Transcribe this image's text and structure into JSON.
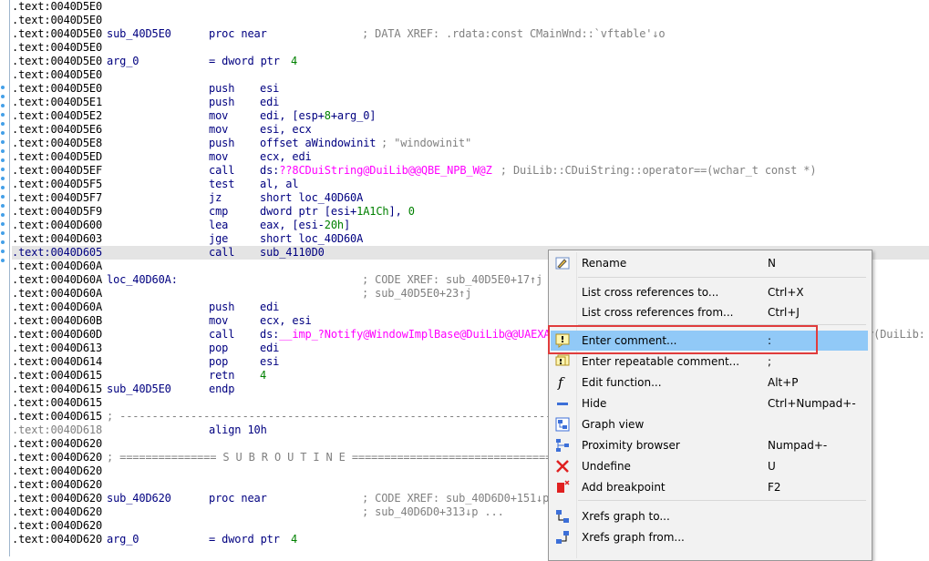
{
  "listing": {
    "rows": [
      {
        "seg": ".text:",
        "addr": "0040D5E0"
      },
      {
        "seg": ".text:",
        "addr": "0040D5E0"
      },
      {
        "seg": ".text:",
        "addr": "0040D5E0",
        "label": "sub_40D5E0",
        "mnem": "proc near",
        "comment": "; DATA XREF: .rdata:const CMainWnd::`vftable'↓o"
      },
      {
        "seg": ".text:",
        "addr": "0040D5E0"
      },
      {
        "seg": ".text:",
        "addr": "0040D5E0",
        "label": "arg_0",
        "mnem": "= dword ptr",
        "op": "4"
      },
      {
        "seg": ".text:",
        "addr": "0040D5E0"
      },
      {
        "seg": ".text:",
        "addr": "0040D5E0",
        "mnem": "push",
        "op": "esi"
      },
      {
        "seg": ".text:",
        "addr": "0040D5E1",
        "mnem": "push",
        "op": "edi"
      },
      {
        "seg": ".text:",
        "addr": "0040D5E2",
        "mnem": "mov",
        "op": "edi, [esp+8+arg_0]"
      },
      {
        "seg": ".text:",
        "addr": "0040D5E6",
        "mnem": "mov",
        "op": "esi, ecx"
      },
      {
        "seg": ".text:",
        "addr": "0040D5E8",
        "mnem": "push",
        "op": "offset aWindowinit",
        "comment": "; \"windowinit\""
      },
      {
        "seg": ".text:",
        "addr": "0040D5ED",
        "mnem": "mov",
        "op": "ecx, edi"
      },
      {
        "seg": ".text:",
        "addr": "0040D5EF",
        "mnem": "call",
        "op": "ds:??8CDuiString@DuiLib@@QBE_NPB_W@Z",
        "comment": "; DuiLib::CDuiString::operator==(wchar_t const *)"
      },
      {
        "seg": ".text:",
        "addr": "0040D5F5",
        "mnem": "test",
        "op": "al, al"
      },
      {
        "seg": ".text:",
        "addr": "0040D5F7",
        "mnem": "jz",
        "op": "short loc_40D60A"
      },
      {
        "seg": ".text:",
        "addr": "0040D5F9",
        "mnem": "cmp",
        "op": "dword ptr [esi+1A1Ch], 0"
      },
      {
        "seg": ".text:",
        "addr": "0040D600",
        "mnem": "lea",
        "op": "eax, [esi-20h]"
      },
      {
        "seg": ".text:",
        "addr": "0040D603",
        "mnem": "jge",
        "op": "short loc_40D60A"
      },
      {
        "seg": ".text:",
        "addr": "0040D605",
        "mnem": "call",
        "op": "sub_4110D0"
      },
      {
        "seg": ".text:",
        "addr": "0040D60A"
      },
      {
        "seg": ".text:",
        "addr": "0040D60A",
        "label": "loc_40D60A:",
        "comment": "; CODE XREF: sub_40D5E0+17↑j"
      },
      {
        "seg": ".text:",
        "addr": "0040D60A",
        "comment": "; sub_40D5E0+23↑j"
      },
      {
        "seg": ".text:",
        "addr": "0040D60A",
        "mnem": "push",
        "op": "edi"
      },
      {
        "seg": ".text:",
        "addr": "0040D60B",
        "mnem": "mov",
        "op": "ecx, esi"
      },
      {
        "seg": ".text:",
        "addr": "0040D60D",
        "mnem": "call",
        "op": "ds:__imp_?Notify@WindowImplBase@DuiLib@@UAEXA",
        "tail": "fy(DuiLib:"
      },
      {
        "seg": ".text:",
        "addr": "0040D613",
        "mnem": "pop",
        "op": "edi"
      },
      {
        "seg": ".text:",
        "addr": "0040D614",
        "mnem": "pop",
        "op": "esi"
      },
      {
        "seg": ".text:",
        "addr": "0040D615",
        "mnem": "retn",
        "op": "4"
      },
      {
        "seg": ".text:",
        "addr": "0040D615",
        "label": "sub_40D5E0",
        "mnem": "endp"
      },
      {
        "seg": ".text:",
        "addr": "0040D615"
      },
      {
        "seg": ".text:",
        "addr": "0040D615",
        "free": "; ---------------------------------------------------------------------------"
      },
      {
        "seg": ".text:",
        "addr": "0040D618",
        "mnem": "align 10h"
      },
      {
        "seg": ".text:",
        "addr": "0040D620"
      },
      {
        "seg": ".text:",
        "addr": "0040D620",
        "free": "; =============== S U B R O U T I N E ======================================="
      },
      {
        "seg": ".text:",
        "addr": "0040D620"
      },
      {
        "seg": ".text:",
        "addr": "0040D620"
      },
      {
        "seg": ".text:",
        "addr": "0040D620",
        "label": "sub_40D620",
        "mnem": "proc near",
        "comment": "; CODE XREF: sub_40D6D0+151↓p"
      },
      {
        "seg": ".text:",
        "addr": "0040D620",
        "comment": "; sub_40D6D0+313↓p ..."
      },
      {
        "seg": ".text:",
        "addr": "0040D620"
      },
      {
        "seg": ".text:",
        "addr": "0040D620",
        "label": "arg_0",
        "mnem": "= dword ptr",
        "op": "4"
      }
    ]
  },
  "context_menu": {
    "items": [
      {
        "icon": "rename-icon",
        "label": "Rename",
        "key": "N"
      },
      {
        "icon": "",
        "label": "List cross references to...",
        "key": "Ctrl+X"
      },
      {
        "icon": "",
        "label": "List cross references from...",
        "key": "Ctrl+J"
      },
      {
        "icon": "comment-icon",
        "label": "Enter comment...",
        "key": ":"
      },
      {
        "icon": "repeatable-comment-icon",
        "label": "Enter repeatable comment...",
        "key": ";"
      },
      {
        "icon": "function-icon",
        "label": "Edit function...",
        "key": "Alt+P"
      },
      {
        "icon": "hide-icon",
        "label": "Hide",
        "key": "Ctrl+Numpad+-"
      },
      {
        "icon": "graph-view-icon",
        "label": "Graph view",
        "key": ""
      },
      {
        "icon": "proximity-browser-icon",
        "label": "Proximity browser",
        "key": "Numpad+-"
      },
      {
        "icon": "undefine-icon",
        "label": "Undefine",
        "key": "U"
      },
      {
        "icon": "breakpoint-icon",
        "label": "Add breakpoint",
        "key": "F2"
      },
      {
        "icon": "xrefs-to-icon",
        "label": "Xrefs graph to...",
        "key": ""
      },
      {
        "icon": "xrefs-from-icon",
        "label": "Xrefs graph from...",
        "key": ""
      }
    ]
  },
  "colors": {
    "selected_item": "#91c9f7",
    "highlight_box": "#e03c3c",
    "address": "#000000",
    "mnemonic": "#000080",
    "name_ref": "#ff00ff",
    "number": "#008000",
    "comment": "#808080"
  }
}
